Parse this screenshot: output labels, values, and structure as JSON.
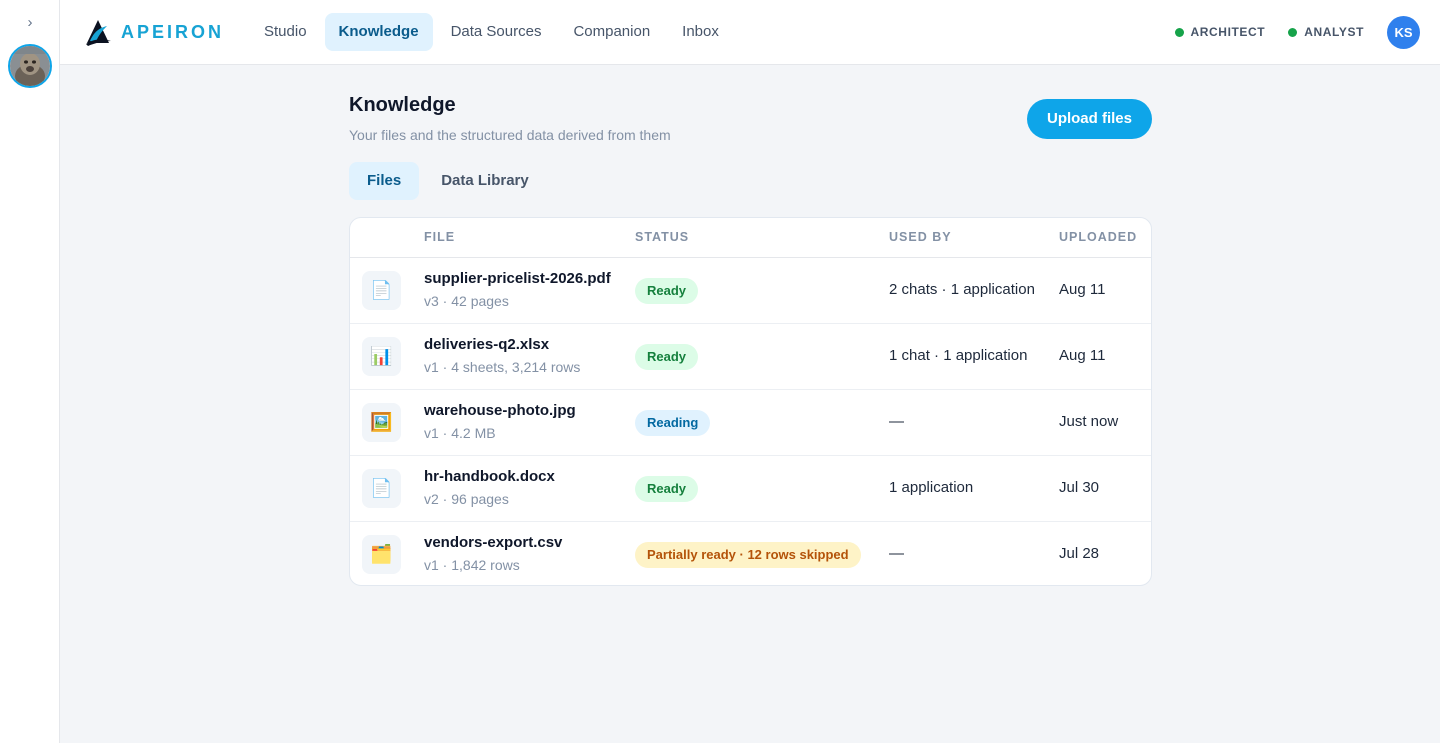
{
  "rail": {
    "expand_icon": "chevron-right-icon",
    "expand_glyph": "›"
  },
  "brand": {
    "name": "APEIRON",
    "accent": "#17a3d4"
  },
  "nav": {
    "items": [
      {
        "label": "Studio",
        "active": false
      },
      {
        "label": "Knowledge",
        "active": true
      },
      {
        "label": "Data Sources",
        "active": false
      },
      {
        "label": "Companion",
        "active": false
      },
      {
        "label": "Inbox",
        "active": false
      }
    ]
  },
  "roles": [
    {
      "label": "ARCHITECT",
      "status_color": "#16a34a"
    },
    {
      "label": "ANALYST",
      "status_color": "#16a34a"
    }
  ],
  "user": {
    "initials": "KS",
    "color": "#2f80ed"
  },
  "page": {
    "title": "Knowledge",
    "subtitle": "Your files and the structured data derived from them",
    "upload_label": "Upload files"
  },
  "tabs": [
    {
      "label": "Files",
      "active": true
    },
    {
      "label": "Data Library",
      "active": false
    }
  ],
  "table": {
    "headers": {
      "file": "FILE",
      "status": "STATUS",
      "used_by": "USED BY",
      "uploaded": "UPLOADED"
    },
    "rows": [
      {
        "icon": "document-icon",
        "glyph": "📄",
        "name": "supplier-pricelist-2026.pdf",
        "meta": "v3 · 42 pages",
        "status": "Ready",
        "status_kind": "ready",
        "used_by": "2 chats · 1 application",
        "uploaded": "Aug 11"
      },
      {
        "icon": "spreadsheet-icon",
        "glyph": "📊",
        "name": "deliveries-q2.xlsx",
        "meta": "v1 · 4 sheets, 3,214 rows",
        "status": "Ready",
        "status_kind": "ready",
        "used_by": "1 chat · 1 application",
        "uploaded": "Aug 11"
      },
      {
        "icon": "image-icon",
        "glyph": "🖼️",
        "name": "warehouse-photo.jpg",
        "meta": "v1 · 4.2 MB",
        "status": "Reading",
        "status_kind": "reading",
        "used_by": "—",
        "uploaded": "Just now"
      },
      {
        "icon": "document-icon",
        "glyph": "📄",
        "name": "hr-handbook.docx",
        "meta": "v2 · 96 pages",
        "status": "Ready",
        "status_kind": "ready",
        "used_by": "1 application",
        "uploaded": "Jul 30"
      },
      {
        "icon": "folder-icon",
        "glyph": "🗂️",
        "name": "vendors-export.csv",
        "meta": "v1 · 1,842 rows",
        "status": "Partially ready · 12 rows skipped",
        "status_kind": "partial",
        "used_by": "—",
        "uploaded": "Jul 28"
      }
    ]
  }
}
